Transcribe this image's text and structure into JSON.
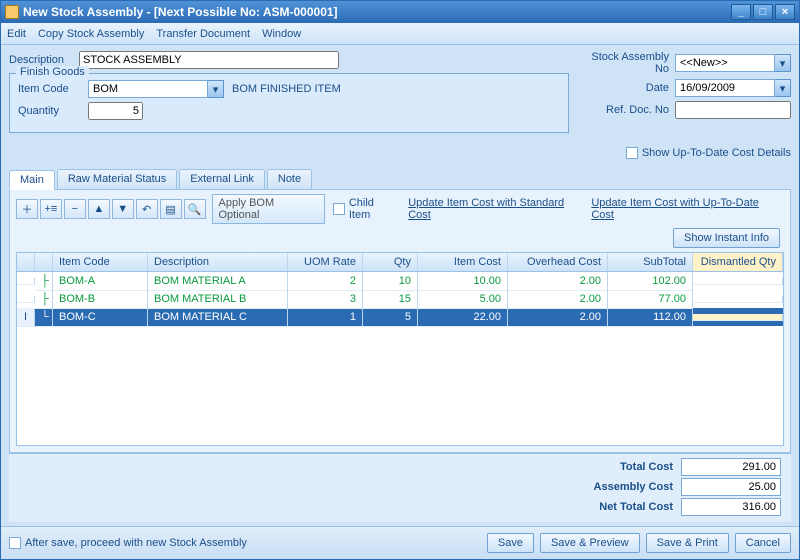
{
  "window": {
    "title": "New Stock Assembly  -  [Next Possible No: ASM-000001]"
  },
  "menu": {
    "edit": "Edit",
    "copy": "Copy Stock Assembly",
    "transfer": "Transfer Document",
    "window": "Window"
  },
  "form": {
    "description_label": "Description",
    "description": "STOCK ASSEMBLY",
    "finish_goods_legend": "Finish Goods",
    "item_code_label": "Item Code",
    "item_code": "BOM",
    "item_code_name": "BOM FINISHED ITEM",
    "quantity_label": "Quantity",
    "quantity": "5",
    "assembly_no_label": "Stock Assembly No",
    "assembly_no": "<<New>>",
    "date_label": "Date",
    "date": "16/09/2009",
    "refdoc_label": "Ref. Doc. No",
    "refdoc": "",
    "show_uptodate": "Show Up-To-Date Cost Details"
  },
  "tabs": {
    "main": "Main",
    "raw": "Raw Material Status",
    "ext": "External Link",
    "note": "Note"
  },
  "toolbar": {
    "apply_bom": "Apply BOM Optional",
    "child_item": "Child Item",
    "update_standard": "Update Item Cost with Standard Cost",
    "update_uptodate": "Update Item Cost with Up-To-Date Cost",
    "show_instant": "Show Instant Info"
  },
  "grid": {
    "headers": {
      "code": "Item Code",
      "desc": "Description",
      "uom": "UOM Rate",
      "qty": "Qty",
      "icost": "Item Cost",
      "ovh": "Overhead Cost",
      "sub": "SubTotal",
      "dis": "Dismantled Qty"
    },
    "rows": [
      {
        "code": "BOM-A",
        "desc": "BOM MATERIAL A",
        "uom": "2",
        "qty": "10",
        "icost": "10.00",
        "ovh": "2.00",
        "sub": "102.00",
        "dis": ""
      },
      {
        "code": "BOM-B",
        "desc": "BOM MATERIAL B",
        "uom": "3",
        "qty": "15",
        "icost": "5.00",
        "ovh": "2.00",
        "sub": "77.00",
        "dis": ""
      },
      {
        "code": "BOM-C",
        "desc": "BOM MATERIAL C",
        "uom": "1",
        "qty": "5",
        "icost": "22.00",
        "ovh": "2.00",
        "sub": "112.00",
        "dis": ""
      }
    ],
    "selected_marker": "I"
  },
  "totals": {
    "total_cost_label": "Total Cost",
    "total_cost": "291.00",
    "assembly_cost_label": "Assembly Cost",
    "assembly_cost": "25.00",
    "net_total_label": "Net Total Cost",
    "net_total": "316.00"
  },
  "footer": {
    "after_save": "After save, proceed with new Stock Assembly",
    "save": "Save",
    "save_preview": "Save & Preview",
    "save_print": "Save & Print",
    "cancel": "Cancel"
  }
}
